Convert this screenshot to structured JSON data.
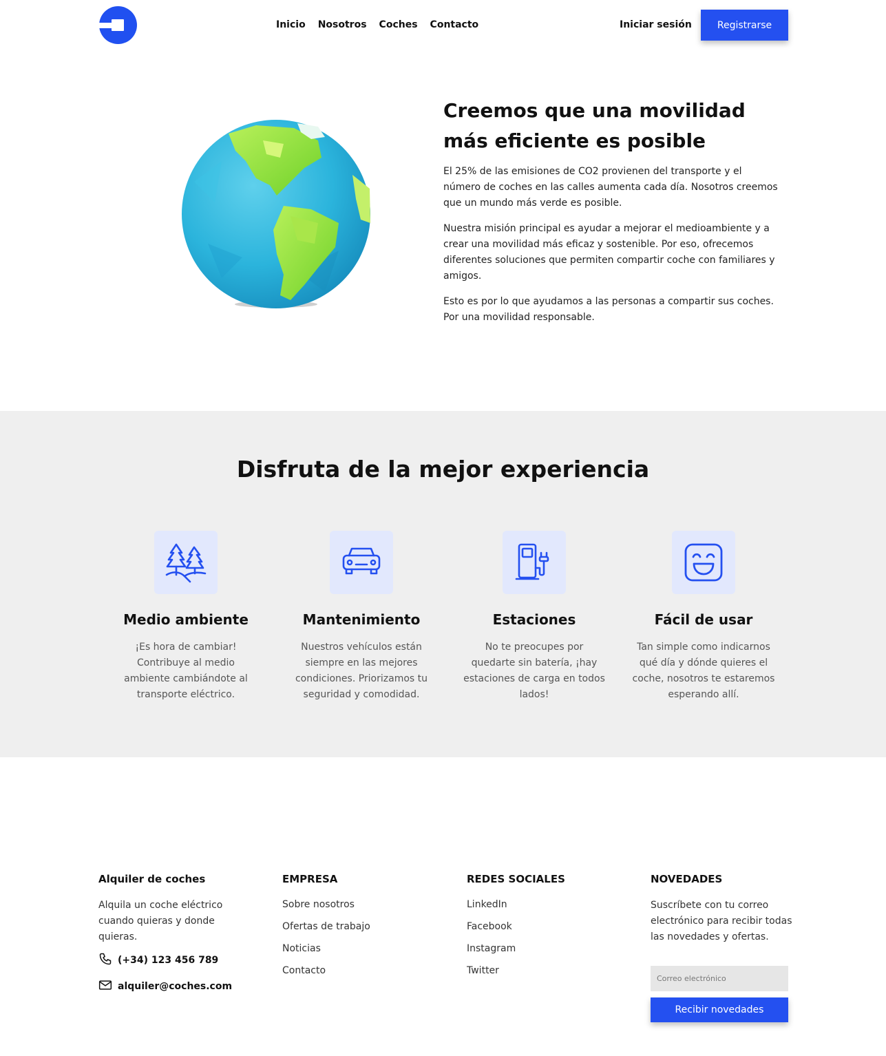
{
  "header": {
    "nav": [
      "Inicio",
      "Nosotros",
      "Coches",
      "Contacto"
    ],
    "login": "Iniciar sesión",
    "register": "Registrarse"
  },
  "hero": {
    "title": "Creemos que una movilidad más eficiente es posible",
    "paragraphs": [
      "El 25% de las emisiones de CO2 provienen del transporte y el número de coches en las calles aumenta cada día. Nosotros creemos que un mundo más verde es posible.",
      "Nuestra misión principal es ayudar a mejorar el medioambiente y a crear una movilidad más eficaz y sostenible. Por eso, ofrecemos diferentes soluciones que permiten compartir coche con familiares y amigos.",
      "Esto es por lo que ayudamos a las personas a compartir sus coches. Por una movilidad responsable."
    ]
  },
  "features": {
    "title": "Disfruta de la mejor experiencia",
    "items": [
      {
        "title": "Medio ambiente",
        "text": "¡Es hora de cambiar! Contribuye al medio ambiente cambiándote al transporte eléctrico.",
        "icon": "trees-icon"
      },
      {
        "title": "Mantenimiento",
        "text": "Nuestros vehículos están siempre en las mejores condiciones. Priorizamos tu seguridad y comodidad.",
        "icon": "car-icon"
      },
      {
        "title": "Estaciones",
        "text": "No te preocupes por quedarte sin batería, ¡hay estaciones de carga en todos lados!",
        "icon": "charging-station-icon"
      },
      {
        "title": "Fácil de usar",
        "text": "Tan simple como indicarnos qué día y dónde quieres el coche, nosotros te estaremos esperando allí.",
        "icon": "smile-icon"
      }
    ]
  },
  "footer": {
    "brand": {
      "title": "Alquiler de coches",
      "text": "Alquila un coche eléctrico cuando quieras y donde quieras.",
      "phone": "(+34) 123 456 789",
      "email": "alquiler@coches.com"
    },
    "company": {
      "title": "EMPRESA",
      "links": [
        "Sobre nosotros",
        "Ofertas de trabajo",
        "Noticias",
        "Contacto"
      ]
    },
    "social": {
      "title": "REDES SOCIALES",
      "links": [
        "LinkedIn",
        "Facebook",
        "Instagram",
        "Twitter"
      ]
    },
    "news": {
      "title": "NOVEDADES",
      "text": "Suscríbete con tu correo electrónico para recibir todas las novedades y ofertas.",
      "placeholder": "Correo electrónico",
      "button": "Recibir novedades"
    }
  },
  "colors": {
    "accent": "#2450f0",
    "icon_bg": "#e2e8fd",
    "section_bg": "#efefef"
  }
}
